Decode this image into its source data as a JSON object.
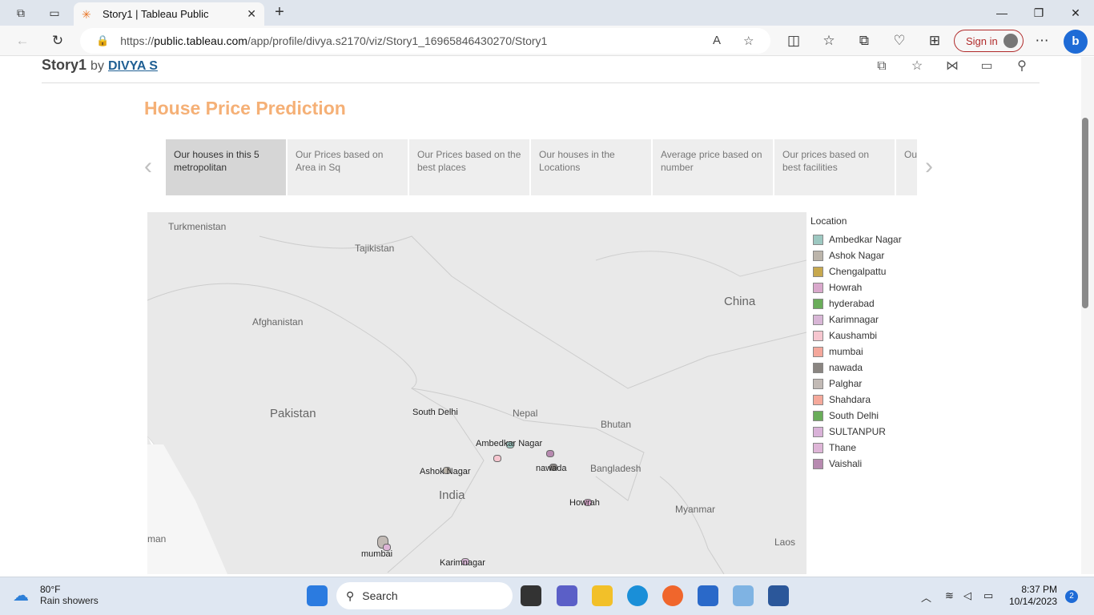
{
  "browser": {
    "tab_title": "Story1 | Tableau Public",
    "url_prefix": "https://",
    "url_host": "public.tableau.com",
    "url_path": "/app/profile/divya.s2170/viz/Story1_16965846430270/Story1",
    "signin_label": "Sign in"
  },
  "story": {
    "title": "Story1",
    "by": "by",
    "author": "DIVYA S"
  },
  "viz": {
    "title": "House Price Prediction",
    "captions": [
      "Our houses in this 5 metropolitan",
      "Our Prices based on Area in Sq",
      "Our Prices based on the best places",
      "Our houses in the Locations",
      "Average price based on number",
      "Our prices based on best facilities",
      "Ou bes"
    ],
    "map_labels": [
      "Turkmenistan",
      "Tajikistan",
      "Afghanistan",
      "China",
      "Pakistan",
      "Nepal",
      "Bhutan",
      "Bangladesh",
      "India",
      "Myanmar",
      "Laos",
      "man"
    ],
    "city_labels": [
      "South Delhi",
      "Ambedkar Nagar",
      "nawada",
      "Ashok Nagar",
      "Howrah",
      "mumbai",
      "Karimnagar"
    ],
    "legend_title": "Location",
    "legend": [
      {
        "label": "Ambedkar Nagar",
        "color": "#9dc8c1"
      },
      {
        "label": "Ashok Nagar",
        "color": "#bcb5ab"
      },
      {
        "label": "Chengalpattu",
        "color": "#c7a84e"
      },
      {
        "label": "Howrah",
        "color": "#d9a8cc"
      },
      {
        "label": "hyderabad",
        "color": "#6aad5a"
      },
      {
        "label": "Karimnagar",
        "color": "#d8b6d6"
      },
      {
        "label": "Kaushambi",
        "color": "#f6c6cf"
      },
      {
        "label": "mumbai",
        "color": "#f4a79b"
      },
      {
        "label": "nawada",
        "color": "#8a8581"
      },
      {
        "label": "Palghar",
        "color": "#c2bab5"
      },
      {
        "label": "Shahdara",
        "color": "#f5a99b"
      },
      {
        "label": "South Delhi",
        "color": "#6aad5a"
      },
      {
        "label": "SULTANPUR",
        "color": "#d9b2d8"
      },
      {
        "label": "Thane",
        "color": "#deb5d7"
      },
      {
        "label": "Vaishali",
        "color": "#b78ab0"
      }
    ]
  },
  "taskbar": {
    "temp": "80°F",
    "weather": "Rain showers",
    "search_label": "Search",
    "time": "8:37 PM",
    "date": "10/14/2023",
    "notif_count": "2"
  }
}
